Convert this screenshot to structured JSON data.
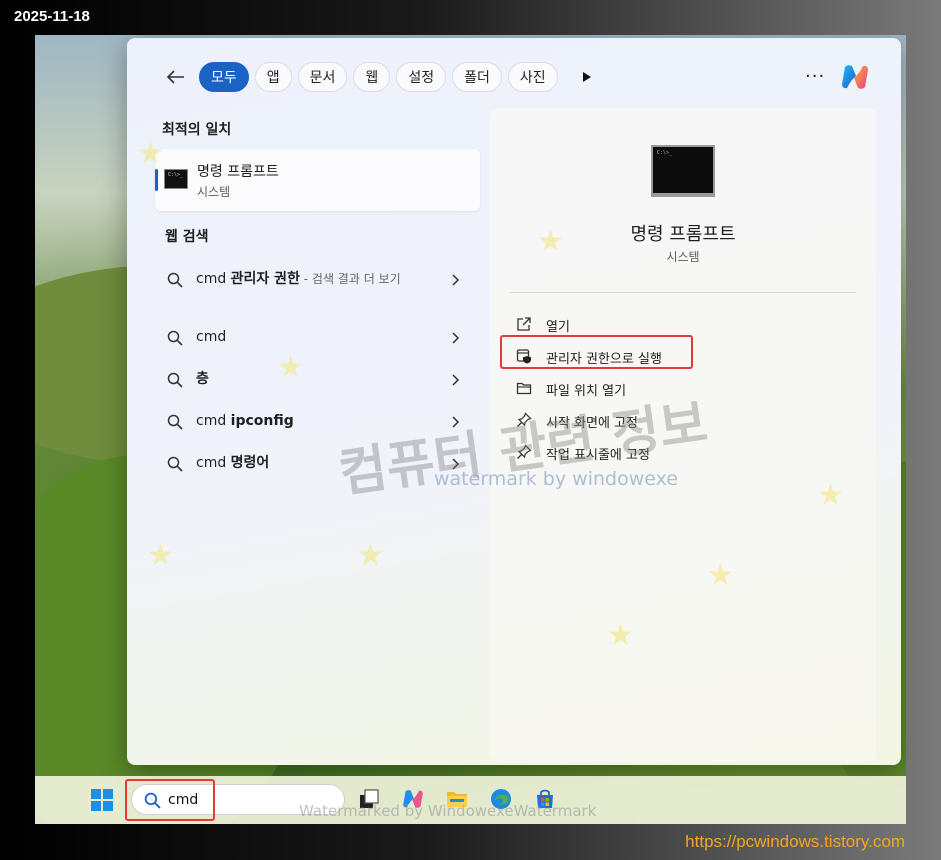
{
  "frame": {
    "date": "2025-11-18",
    "url": "https://pcwindows.tistory.com"
  },
  "filter_bar": {
    "tabs": [
      {
        "label": "모두",
        "active": true
      },
      {
        "label": "앱"
      },
      {
        "label": "문서"
      },
      {
        "label": "웹"
      },
      {
        "label": "설정"
      },
      {
        "label": "폴더"
      },
      {
        "label": "사진"
      }
    ],
    "more": "···"
  },
  "best_match": {
    "section": "최적의 일치",
    "title": "명령 프롬프트",
    "subtitle": "시스템"
  },
  "web_search": {
    "section": "웹 검색",
    "items": [
      {
        "prefix": "cmd ",
        "bold": "관리자 권한",
        "hint": " - 검색 결과 더 보기"
      },
      {
        "prefix": "cmd",
        "bold": "",
        "hint": ""
      },
      {
        "prefix": "",
        "bold": "층",
        "hint": ""
      },
      {
        "prefix": "cmd ",
        "bold": "ipconfig",
        "hint": ""
      },
      {
        "prefix": "cmd ",
        "bold": "명령어",
        "hint": ""
      }
    ]
  },
  "details": {
    "title": "명령 프롬프트",
    "subtitle": "시스템",
    "actions": [
      {
        "label": "열기",
        "icon": "open-external-icon"
      },
      {
        "label": "관리자 권한으로 실행",
        "icon": "shield-admin-icon"
      },
      {
        "label": "파일 위치 열기",
        "icon": "folder-icon"
      },
      {
        "label": "시작 화면에 고정",
        "icon": "pin-icon"
      },
      {
        "label": "작업 표시줄에 고정",
        "icon": "pin-icon"
      }
    ]
  },
  "watermarks": {
    "korean": "컴퓨터 관련 정보",
    "english": "watermark by windowexe",
    "taskbar": "Watermarked by WindowexeWatermark"
  },
  "taskbar": {
    "search_value": "cmd"
  },
  "colors": {
    "accent": "#1a63c4",
    "highlight": "#e53935",
    "url": "#f5a623"
  }
}
